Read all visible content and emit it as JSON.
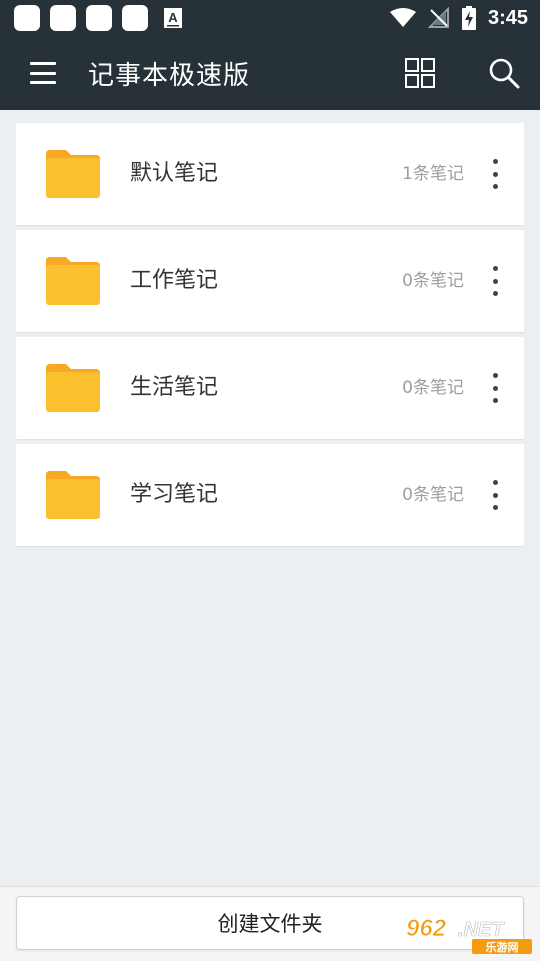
{
  "status_bar": {
    "time": "3:45",
    "notification_icons": [
      "app-notification-icon",
      "app-notification-icon",
      "app-notification-icon",
      "app-notification-icon",
      "font-a-icon"
    ],
    "system_icons": [
      "wifi-icon",
      "signal-off-icon",
      "battery-charging-icon"
    ]
  },
  "app_bar": {
    "title": "记事本极速版",
    "icons": [
      "menu-icon",
      "grid-view-icon",
      "search-icon"
    ]
  },
  "folders": [
    {
      "name": "默认笔记",
      "count": "1条笔记"
    },
    {
      "name": "工作笔记",
      "count": "0条笔记"
    },
    {
      "name": "生活笔记",
      "count": "0条笔记"
    },
    {
      "name": "学习笔记",
      "count": "0条笔记"
    }
  ],
  "bottom": {
    "create_label": "创建文件夹"
  },
  "watermark": {
    "text": "962.NET",
    "subtext": "乐游网"
  },
  "colors": {
    "toolbar": "#263238",
    "background": "#eceff1",
    "folder": "#fbc02d",
    "count_text": "#9e9e9e",
    "watermark_orange": "#f39c12"
  }
}
